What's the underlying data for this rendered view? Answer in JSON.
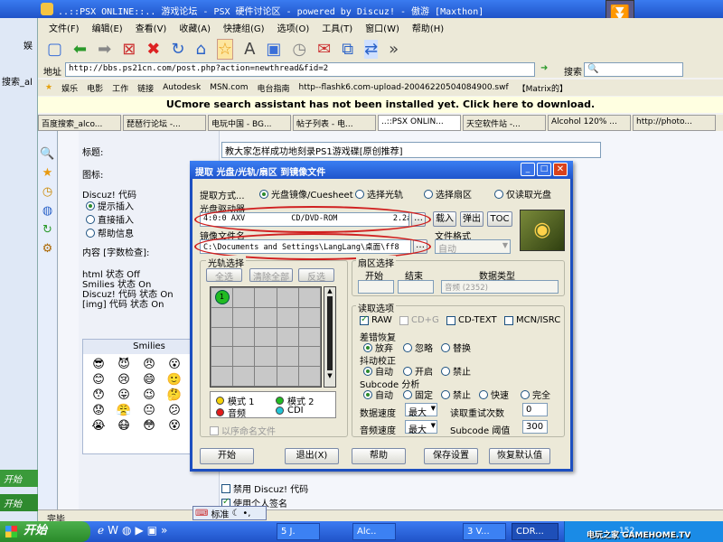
{
  "browser": {
    "title": "..::PSX ONLINE::.. 游戏论坛 - PSX 硬件讨论区 - powered by Discuz! - 傲游 [Maxthon]",
    "menu": [
      "文件(F)",
      "编辑(E)",
      "查看(V)",
      "收藏(A)",
      "快捷组(G)",
      "选项(O)",
      "工具(T)",
      "窗口(W)",
      "帮助(H)"
    ],
    "address_label": "地址",
    "address": "http://bbs.ps21cn.com/post.php?action=newthread&fid=2",
    "search_label": "搜索",
    "favorites": [
      "娱乐",
      "电影",
      "工作",
      "链接",
      "Autodesk",
      "MSN.com",
      "电台指南",
      "http--flashk6.com-upload-20046220504084900.swf",
      "【Matrix的】"
    ],
    "notice": "UCmore search assistant has not been installed yet. Click here to download.",
    "tabs": [
      "百度搜索_alco...",
      "琵琶行论坛 -...",
      "电玩中国 - BG...",
      "帖子列表 - 电...",
      "..::PSX ONLIN...",
      "天空软件站 -...",
      "Alcohol 120% ...",
      "http://photo..."
    ],
    "left_fragments": [
      "娱",
      "搜索_al"
    ]
  },
  "forum": {
    "subject_label": "标题:",
    "subject_value": "教大家怎样成功地刻录PS1游戏碟[原创推荐]",
    "icon_label": "图标:",
    "discuz_label": "Discuz! 代码",
    "discuz_options": [
      "提示插入",
      "直接插入",
      "帮助信息"
    ],
    "content_label": "内容 [字数检查]:",
    "status_lines": [
      "html 状态 Off",
      "Smilies 状态 On",
      "Discuz! 代码 状态 On",
      "[img] 代码 状态 On"
    ],
    "smilies_title": "Smilies",
    "smilies": [
      "😎",
      "😈",
      "😠",
      "😮",
      "😲",
      "😊",
      "😢",
      "😄",
      "🙂",
      "😀",
      "😯",
      "😛",
      "😉",
      "🤔",
      "😡",
      "😟",
      "😤",
      "😐",
      "😕",
      "🤓",
      "😭",
      "😷",
      "😳",
      "😵",
      "😁"
    ],
    "checkbox1": "禁用 Discuz! 代码",
    "checkbox2": "使用个人签名"
  },
  "dialog": {
    "title": "提取 光盘/光轨/扇区 到镜像文件",
    "method_label": "提取方式...",
    "methods": [
      "光盘镜像/Cuesheet",
      "选择光轨",
      "选择扇区",
      "仅读取光盘"
    ],
    "drive_label": "光盘驱动器",
    "drive_value": "4:0:0 AXV          CD/DVD-ROM            2.2a",
    "btn_load": "载入",
    "btn_eject": "弹出",
    "btn_toc": "TOC",
    "image_label": "镜像文件名",
    "image_value": "C:\\Documents and Settings\\LangLang\\桌面\\ff8",
    "format_label": "文件格式",
    "format_value": "自动",
    "track_group": "光轨选择",
    "btn_all": "全选",
    "btn_clear": "清除全部",
    "btn_invert": "反选",
    "track1": "1",
    "legend": [
      "模式 1",
      "模式 2",
      "音频",
      "CDI"
    ],
    "sequence_label": "以序命名文件",
    "sector_group": "扇区选择",
    "sector_headers": [
      "开始",
      "结束",
      "数据类型"
    ],
    "sector_type": "音频  (2352)",
    "read_group": "读取选项",
    "read_checks": [
      "RAW",
      "CD+G",
      "CD-TEXT",
      "MCN/ISRC"
    ],
    "error_label": "差错恢复",
    "error_opts": [
      "放弃",
      "忽略",
      "替换"
    ],
    "jitter_label": "抖动校正",
    "jitter_opts": [
      "自动",
      "开启",
      "禁止"
    ],
    "subcode_label": "Subcode 分析",
    "subcode_opts": [
      "自动",
      "固定",
      "禁止",
      "快速",
      "完全"
    ],
    "data_speed_label": "数据速度",
    "data_speed": "最大",
    "retry_label": "读取重试次数",
    "retry": "0",
    "audio_speed_label": "音频速度",
    "audio_speed": "最大",
    "threshold_label": "Subcode 阈值",
    "threshold": "300",
    "btn_start": "开始",
    "btn_exit": "退出(X)",
    "btn_help": "帮助",
    "btn_save": "保存设置",
    "btn_restore": "恢复默认值"
  },
  "taskbar": {
    "start": "开始",
    "ime": "标准",
    "items": [
      "5 J.",
      "Alc..",
      "3 V...",
      "CDR..."
    ],
    "tray": "152",
    "logo": "电玩之家 GAMEHOME.TV"
  },
  "status_bar": "完毕",
  "colors": {
    "xp_blue": "#0a246a",
    "title_grad": "#2a6de0",
    "red_oval": "#d02020",
    "green": "#22aa22"
  }
}
